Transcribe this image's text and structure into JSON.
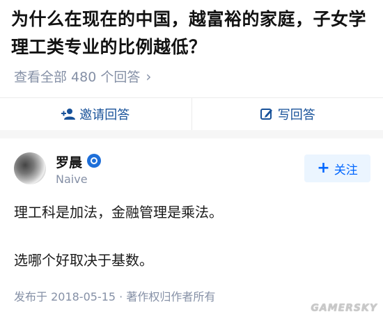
{
  "question": {
    "title": "为什么在现在的中国，越富裕的家庭，子女学理工类专业的比例越低？",
    "view_all": "查看全部 480 个回答"
  },
  "actions": {
    "invite_label": "邀请回答",
    "write_label": "写回答"
  },
  "answer": {
    "author_name": "罗晨",
    "author_headline": "Naive",
    "follow_label": "关注",
    "paragraphs": [
      "理工科是加法，金融管理是乘法。",
      "选哪个好取决于基数。"
    ],
    "meta": "发布于 2018-05-15 · 著作权归作者所有"
  },
  "watermark": "GAMERSKY",
  "colors": {
    "link_blue": "#175199",
    "accent_blue": "#0066ff",
    "muted_gray": "#8590a6"
  }
}
